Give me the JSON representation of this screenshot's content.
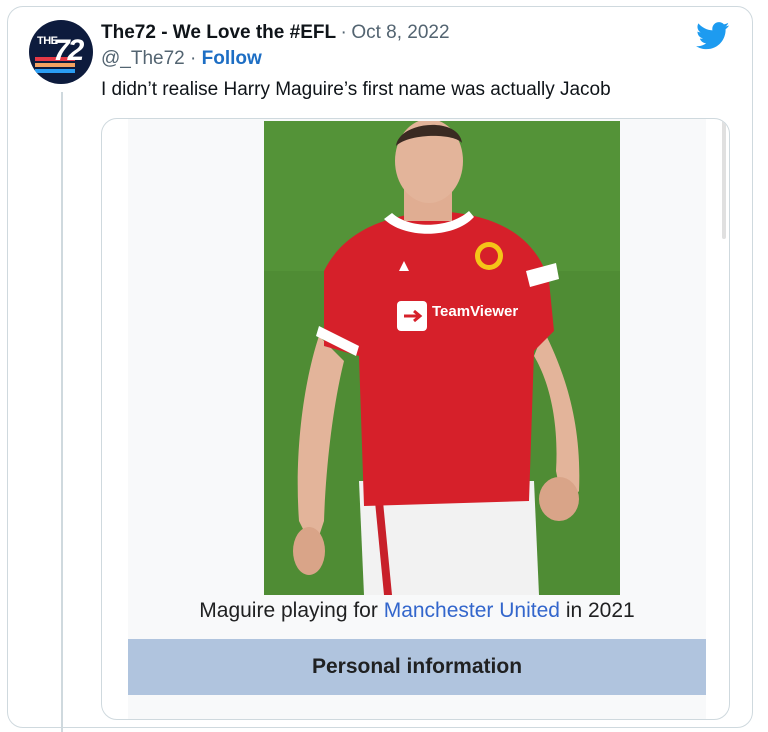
{
  "tweet": {
    "display_name": "The72 - We Love the #EFL",
    "separator": "·",
    "date": "Oct 8, 2022",
    "handle": "@_The72",
    "handle_sep": "·",
    "follow_label": "Follow",
    "text": "I didn’t realise Harry Maguire’s first name was actually Jacob"
  },
  "avatar": {
    "prefix": "THE",
    "number": "72"
  },
  "media": {
    "caption_prefix": "Maguire playing for",
    "caption_link": "Manchester United",
    "caption_suffix": "in 2021",
    "section_header": "Personal information",
    "shirt_sponsor": "TeamViewer"
  },
  "colors": {
    "twitter_blue": "#1d9bf0",
    "link_blue": "#3366cc",
    "infobox_header": "#b0c4de",
    "shirt_red": "#d6202a"
  },
  "icons": [
    "twitter-bird-icon"
  ]
}
